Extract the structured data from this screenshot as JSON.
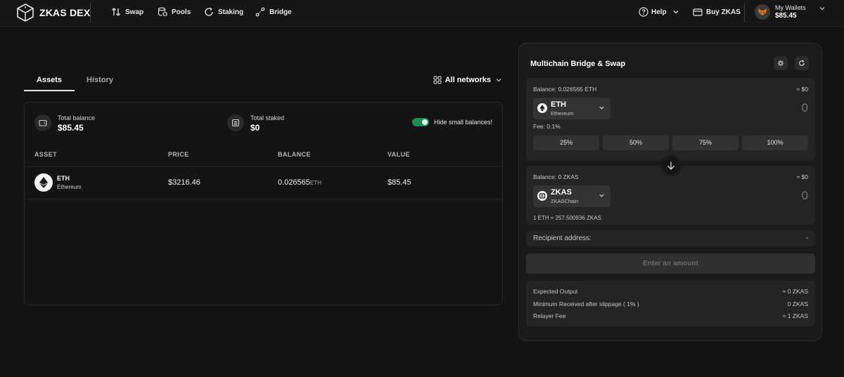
{
  "header": {
    "brand": "ZKAS DEX",
    "nav": [
      {
        "label": "Swap",
        "icon": "swap-arrows-icon"
      },
      {
        "label": "Pools",
        "icon": "database-icon"
      },
      {
        "label": "Staking",
        "icon": "refresh-circle-icon"
      },
      {
        "label": "Bridge",
        "icon": "bridge-icon"
      }
    ],
    "help_label": "Help",
    "buy_label": "Buy ZKAS",
    "wallet_label": "My Wallets",
    "wallet_amount": "$85.45"
  },
  "tabs": [
    "Assets",
    "History"
  ],
  "network_selector": "All networks",
  "summary": {
    "total_balance_label": "Total balance",
    "total_balance": "$85.45",
    "total_staked_label": "Total staked",
    "total_staked": "$0",
    "hide_small_label": "Hide small balances!",
    "hide_small_on": true
  },
  "table": {
    "columns": [
      "ASSET",
      "PRICE",
      "BALANCE",
      "VALUE"
    ],
    "rows": [
      {
        "symbol": "ETH",
        "name": "Ethereum",
        "price": "$3216.46",
        "balance": "0.026565",
        "balance_unit": "ETH",
        "value": "$85.45"
      }
    ]
  },
  "bridge": {
    "title": "Multichain Bridge & Swap",
    "from": {
      "balance": "Balance: 0.026565 ETH",
      "usd": "≈ $0",
      "symbol": "ETH",
      "chain": "Ethereum",
      "amount": "0",
      "fee": "Fee: 0.1%"
    },
    "percent_buttons": [
      "25%",
      "50%",
      "75%",
      "100%"
    ],
    "to": {
      "balance": "Balance: 0 ZKAS",
      "usd": "≈ $0",
      "symbol": "ZKAS",
      "chain": "ZKASChain",
      "amount": "0",
      "rate": "1 ETH ≈ 257.500936 ZKAS"
    },
    "recipient_label": "Recipient address:",
    "recipient_value": "-",
    "action_button": "Enter an amount",
    "details": [
      {
        "label": "Expected Output",
        "value": "≈ 0 ZKAS"
      },
      {
        "label": "Minimum Received after slippage ( 1% )",
        "value": "0 ZKAS"
      },
      {
        "label": "Relayer Fee",
        "value": "≈ 1 ZKAS"
      }
    ]
  },
  "colors": {
    "background": "#131313",
    "toggle_on": "#1e8a5c",
    "panel": "#1a1a1a"
  }
}
